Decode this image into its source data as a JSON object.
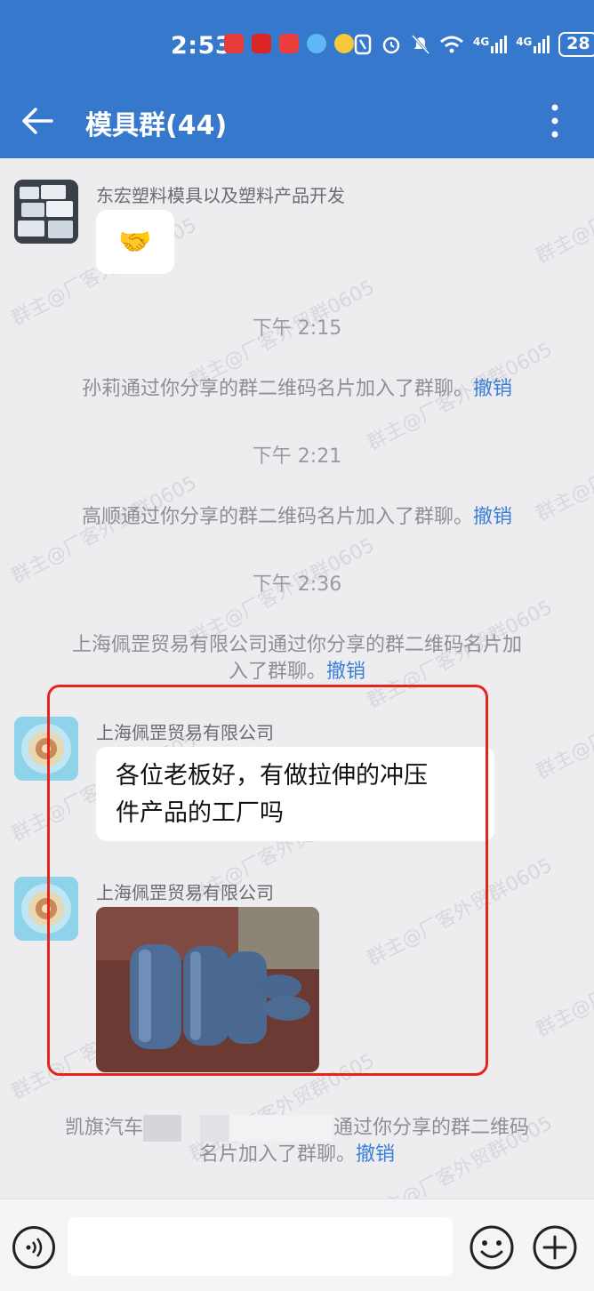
{
  "status": {
    "time": "2:53",
    "net1": "4G",
    "net2": "4G",
    "battery": "28"
  },
  "header": {
    "title": "模具群(44)"
  },
  "watermark_text": "群主@厂客外贸群0605",
  "messages": {
    "msg1": {
      "sender": "东宏塑料模具以及塑料产品开发",
      "emoji": "🤝"
    },
    "ts1": "下午 2:15",
    "sys1": {
      "text": "孙莉通过你分享的群二维码名片加入了群聊。",
      "action": "撤销"
    },
    "ts2": "下午 2:21",
    "sys2": {
      "text": "高顺通过你分享的群二维码名片加入了群聊。",
      "action": "撤销"
    },
    "ts3": "下午 2:36",
    "sys3": {
      "line1": "上海佩罡贸易有限公司通过你分享的群二维码名片加",
      "line2": "入了群聊。",
      "action": "撤销"
    },
    "msg2": {
      "sender": "上海佩罡贸易有限公司",
      "line1": "各位老板好，有做拉伸的冲压",
      "line2": "件产品的工厂吗"
    },
    "msg3": {
      "sender": "上海佩罡贸易有限公司"
    },
    "sys4": {
      "line1_left": "凯旗汽车",
      "line1_right": "通过你分享的群二维码",
      "line2": "名片加入了群聊。",
      "action": "撤销"
    }
  },
  "inputbar": {
    "placeholder": ""
  },
  "colors": {
    "header": "#3678cb",
    "link": "#3a7fd5",
    "highlight": "#e8231d"
  }
}
